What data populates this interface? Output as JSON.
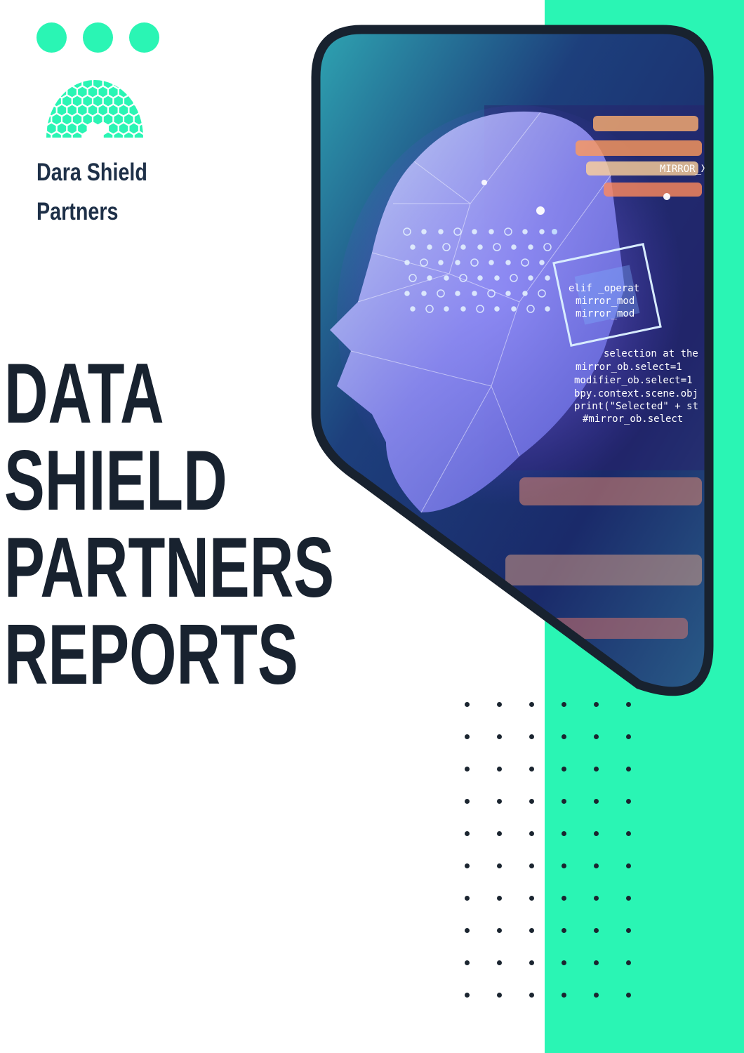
{
  "colors": {
    "accent": "#2af5b4",
    "dark": "#18222f",
    "brand_text": "#1e3048"
  },
  "brand": {
    "line1": "Dara Shield",
    "line2": "Partners",
    "logo_icon": "hexagon-dome-logo-icon"
  },
  "headline": {
    "line1": "DATA",
    "line2": "SHIELD",
    "line3": "PARTNERS",
    "line4": "REPORTS"
  },
  "hero_image": {
    "subject": "ai-digital-head-icon",
    "code_lines": [
      "MIRROR_X",
      "elif _operat",
      "mirror_mod",
      "mirror_mod",
      "selection at the",
      "mirror_ob.select=1",
      "modifier_ob.select=1",
      "bpy.context.scene.obj",
      "print(\"Selected\" + st",
      "#mirror_ob.select"
    ]
  }
}
